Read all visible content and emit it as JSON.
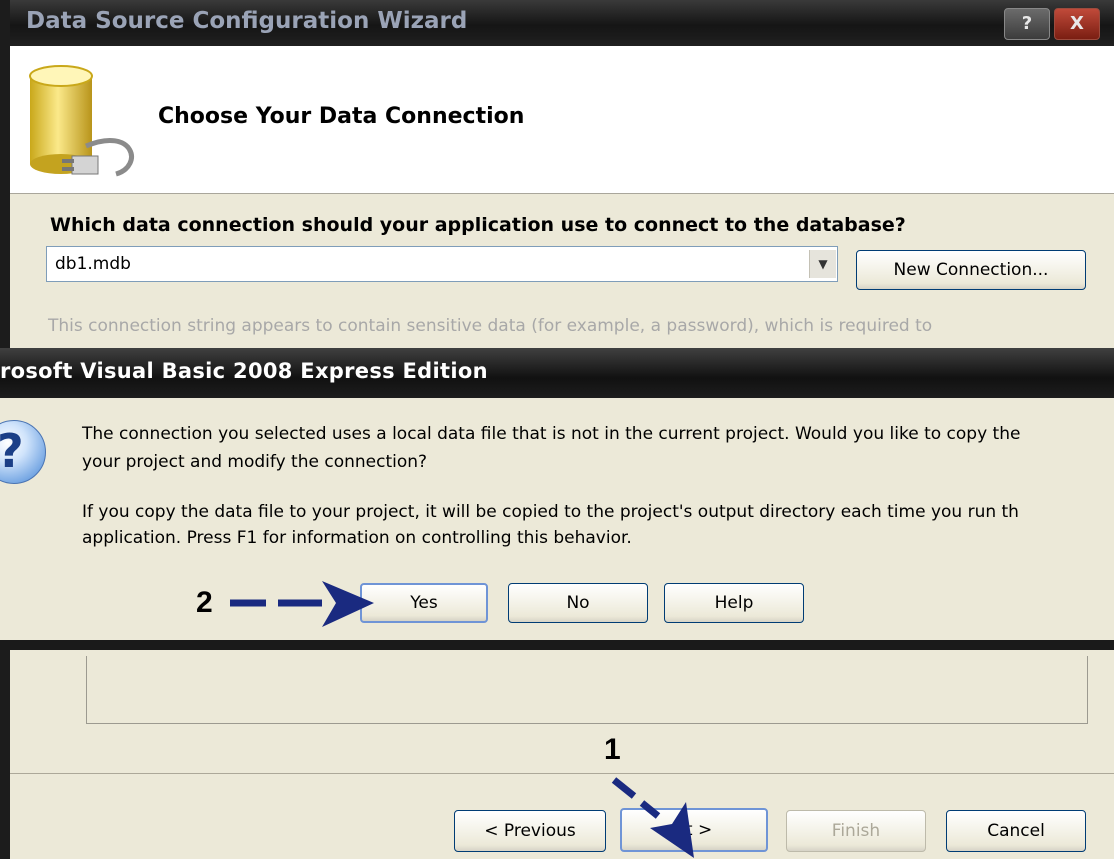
{
  "wizard": {
    "title": "Data Source Configuration Wizard",
    "header_title": "Choose Your Data Connection",
    "help_glyph": "?",
    "close_glyph": "X",
    "question": "Which data connection should your application use to connect to the database?",
    "connection_value": "db1.mdb",
    "new_connection_label": "New Connection...",
    "sensitive_text": "This connection string appears to contain sensitive data (for example, a password), which is required to",
    "buttons": {
      "previous": "< Previous",
      "next": "xt >",
      "finish": "Finish",
      "cancel": "Cancel"
    }
  },
  "messagebox": {
    "title": "rosoft Visual Basic 2008 Express Edition",
    "icon": "question-icon",
    "line1": "The connection you selected uses a local data file that is not in the current project. Would you like to copy the",
    "line2": "your project and modify the connection?",
    "line3": "If you copy the data file to your project, it will be copied to the project's output directory each time you run th",
    "line4": "application. Press F1 for information on controlling this behavior.",
    "buttons": {
      "yes": "Yes",
      "no": "No",
      "help": "Help"
    }
  },
  "annotations": {
    "step1": "1",
    "step2": "2",
    "arrow_color": "#1a2a80"
  }
}
